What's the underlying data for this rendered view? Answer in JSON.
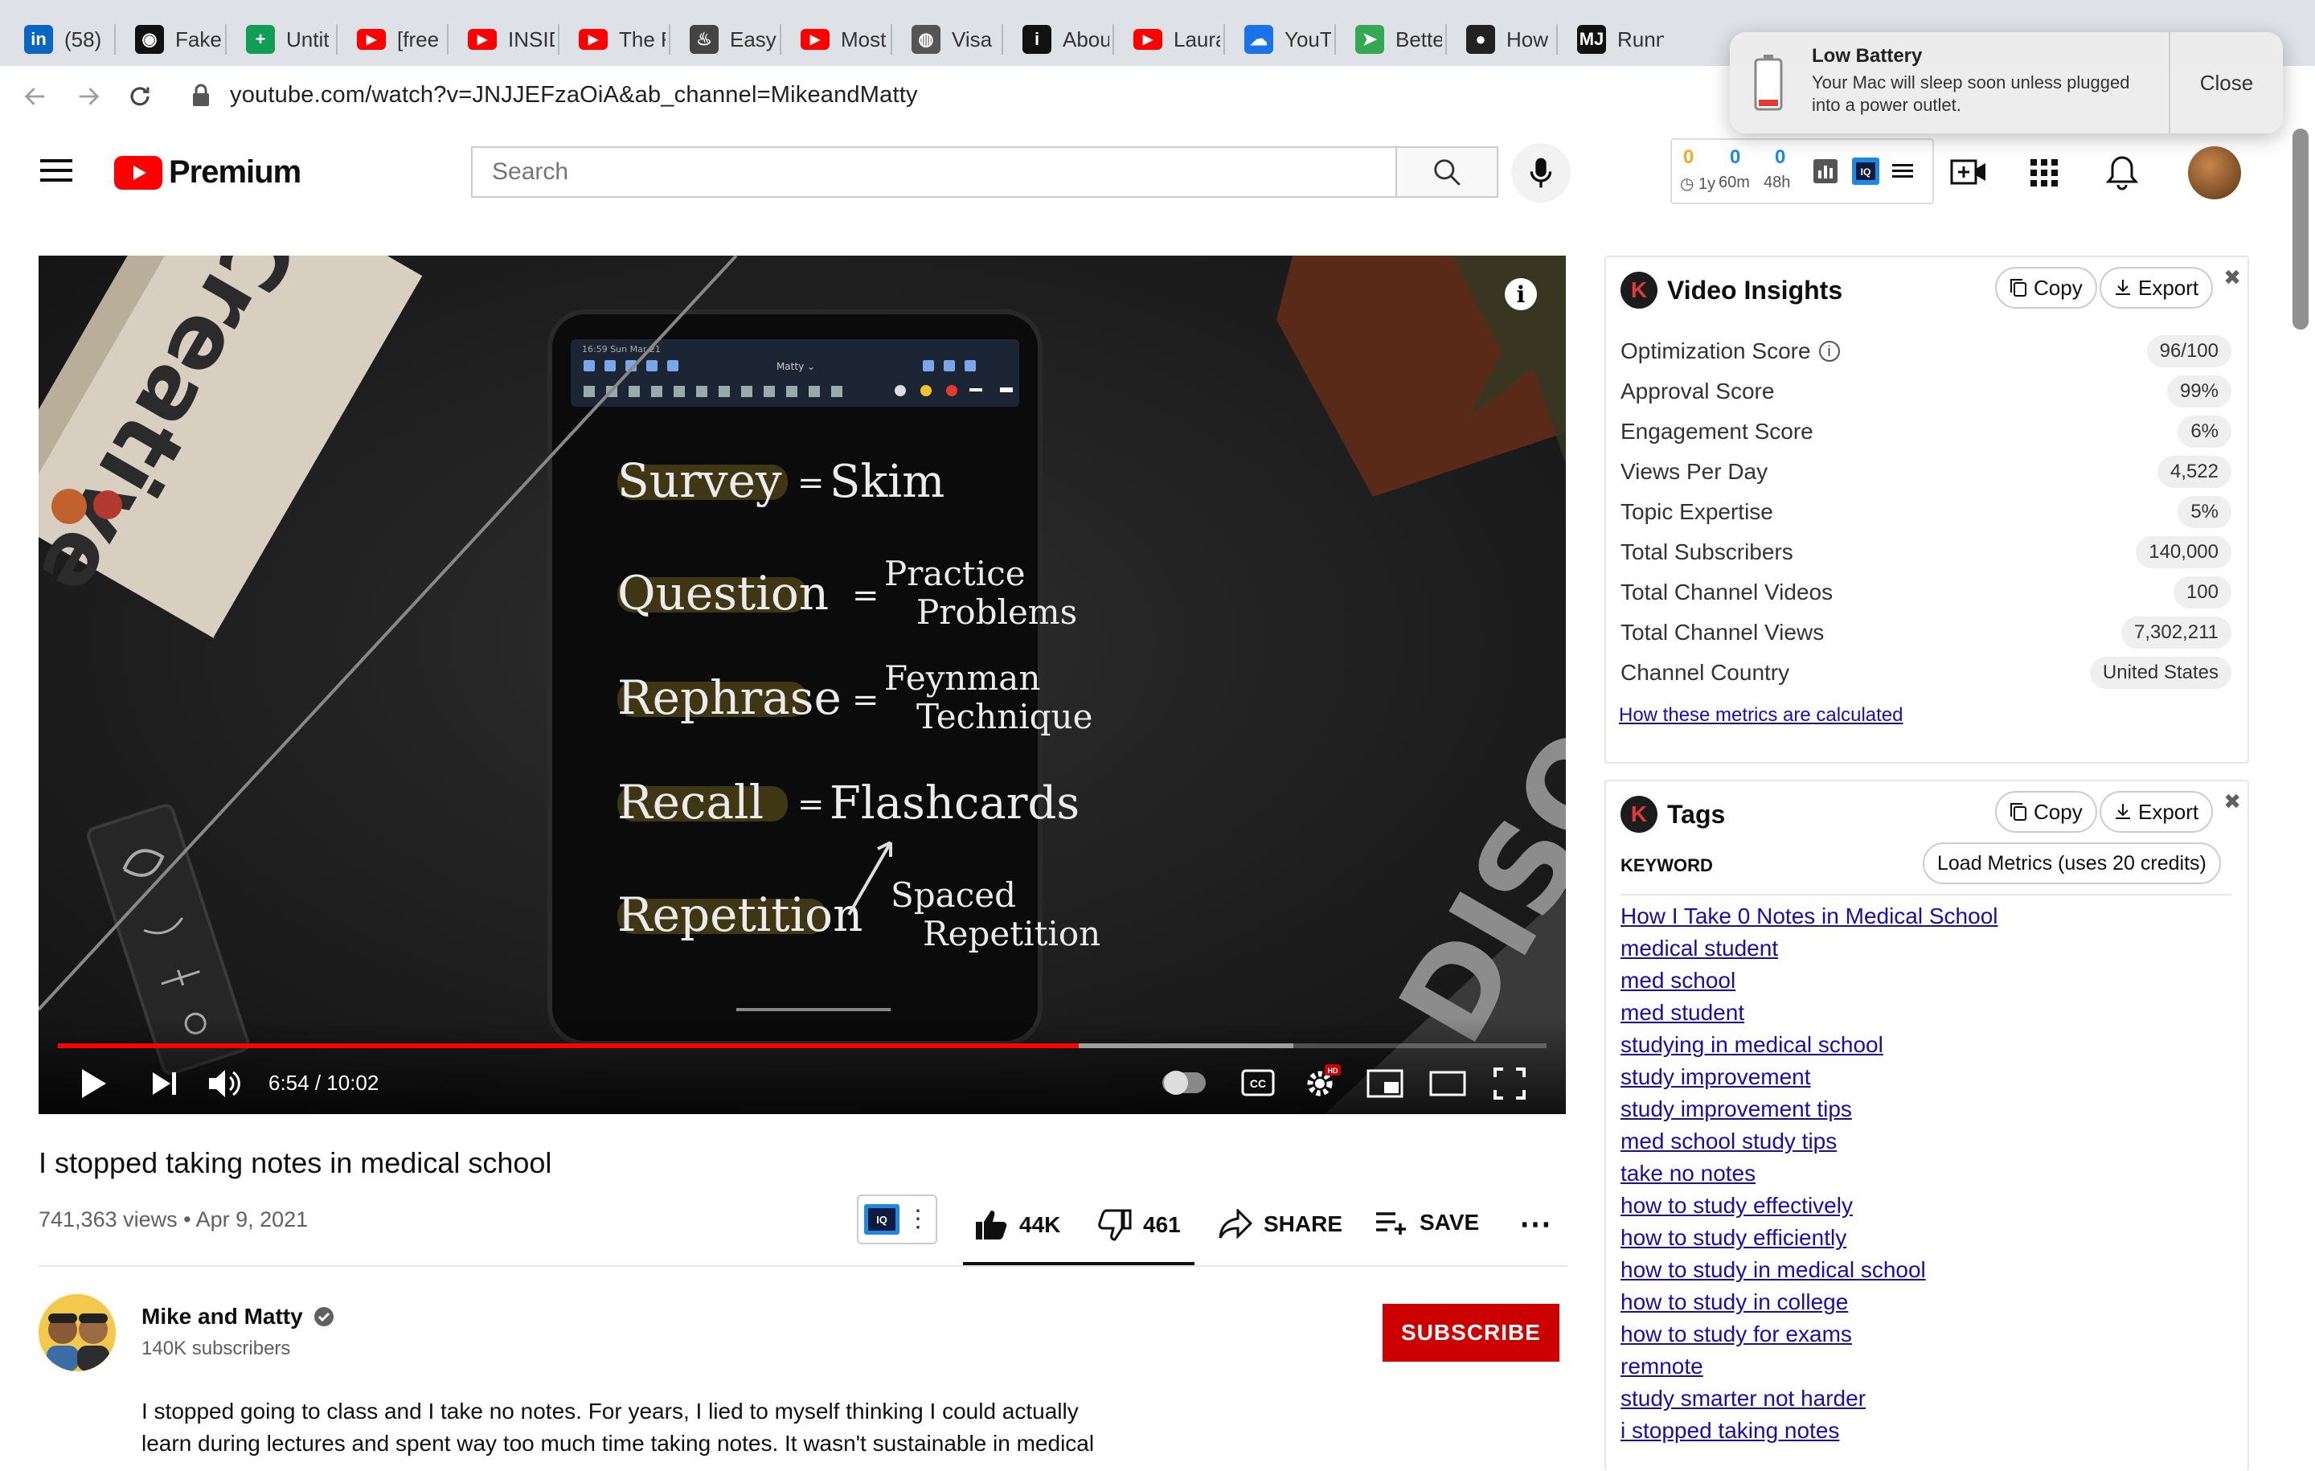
{
  "tabs": [
    {
      "label": "(58)",
      "icon": "linkedin-icon",
      "color": "#0a66c2"
    },
    {
      "label": "Fake",
      "icon": "camera-icon",
      "color": "#111111"
    },
    {
      "label": "Untit",
      "icon": "sheets-icon",
      "color": "#0f9d58"
    },
    {
      "label": "[free",
      "icon": "youtube-icon",
      "color": "#ff0000"
    },
    {
      "label": "INSID",
      "icon": "youtube-icon",
      "color": "#ff0000"
    },
    {
      "label": "The F",
      "icon": "youtube-icon",
      "color": "#ff0000"
    },
    {
      "label": "Easy",
      "icon": "bowl-icon",
      "color": "#444444"
    },
    {
      "label": "Most",
      "icon": "youtube-icon",
      "color": "#ff0000"
    },
    {
      "label": "Visa",
      "icon": "globe-icon",
      "color": "#555555"
    },
    {
      "label": "Abou",
      "icon": "italic-i-icon",
      "color": "#111111"
    },
    {
      "label": "Laura",
      "icon": "youtube-icon",
      "color": "#ff0000"
    },
    {
      "label": "YouTu",
      "icon": "cloud-upload-icon",
      "color": "#1a73e8"
    },
    {
      "label": "Bette",
      "icon": "leaf-icon",
      "color": "#34a853"
    },
    {
      "label": "How",
      "icon": "dot-icon",
      "color": "#222222"
    },
    {
      "label": "Runn",
      "icon": "mj-icon",
      "color": "#111111"
    }
  ],
  "browser": {
    "url": "youtube.com/watch?v=JNJJEFzaOiA&ab_channel=MikeandMatty"
  },
  "notification": {
    "title": "Low Battery",
    "body_line1": "Your Mac will sleep soon unless plugged",
    "body_line2": "into a power outlet.",
    "close_label": "Close"
  },
  "masthead": {
    "logo_text": "Premium",
    "search_placeholder": "Search",
    "stats": [
      {
        "value": "0",
        "label": "1y",
        "color": "#f9a825"
      },
      {
        "value": "0",
        "label": "60m",
        "color": "#1e88e5"
      },
      {
        "value": "0",
        "label": "48h",
        "color": "#1e88e5"
      }
    ]
  },
  "player": {
    "time": "6:54 / 10:02",
    "progress": 0.686,
    "buffered": 0.83,
    "board": {
      "status": "16:59  Sun Mar 21",
      "doc_title": "Matty ⌄",
      "rows": [
        {
          "left": "Survey",
          "right": "Skim"
        },
        {
          "left": "Question",
          "right": "Practice",
          "right2": "Problems"
        },
        {
          "left": "Rephrase",
          "right": "Feynman",
          "right2": "Technique"
        },
        {
          "left": "Recall",
          "right": "Flashcards"
        },
        {
          "left": "Repetition",
          "right": "Spaced",
          "right2": "Repetition"
        }
      ]
    }
  },
  "video": {
    "title": "I stopped taking notes in medical school",
    "views_date": "741,363 views • Apr 9, 2021",
    "likes": "44K",
    "dislikes": "461",
    "share": "SHARE",
    "save": "SAVE"
  },
  "channel": {
    "name": "Mike and Matty",
    "subs": "140K subscribers",
    "subscribe_label": "SUBSCRIBE",
    "description_line1": "I stopped going to class and I take no notes. For years, I lied to myself thinking I could actually",
    "description_line2": "learn during lectures and spent way too much time taking notes. It wasn't sustainable in medical"
  },
  "insights": {
    "title": "Video Insights",
    "copy": "Copy",
    "export": "Export",
    "metrics": [
      {
        "label": "Optimization Score",
        "value": "96/100",
        "info": true
      },
      {
        "label": "Approval Score",
        "value": "99%"
      },
      {
        "label": "Engagement Score",
        "value": "6%"
      },
      {
        "label": "Views Per Day",
        "value": "4,522"
      },
      {
        "label": "Topic Expertise",
        "value": "5%"
      },
      {
        "label": "Total Subscribers",
        "value": "140,000"
      },
      {
        "label": "Total Channel Videos",
        "value": "100"
      },
      {
        "label": "Total Channel Views",
        "value": "7,302,211"
      },
      {
        "label": "Channel Country",
        "value": "United States"
      }
    ],
    "how_link": "How these metrics are calculated"
  },
  "tags": {
    "title": "Tags",
    "copy": "Copy",
    "export": "Export",
    "column": "KEYWORD",
    "load_btn": "Load Metrics (uses 20 credits)",
    "items": [
      "How I Take 0 Notes in Medical School",
      "medical student",
      "med school",
      "med student",
      "studying in medical school",
      "study improvement",
      "study improvement tips",
      "med school study tips",
      "take no notes",
      "how to study effectively",
      "how to study efficiently",
      "how to study in medical school",
      "how to study in college",
      "how to study for exams",
      "remnote",
      "study smarter not harder",
      "i stopped taking notes"
    ]
  }
}
